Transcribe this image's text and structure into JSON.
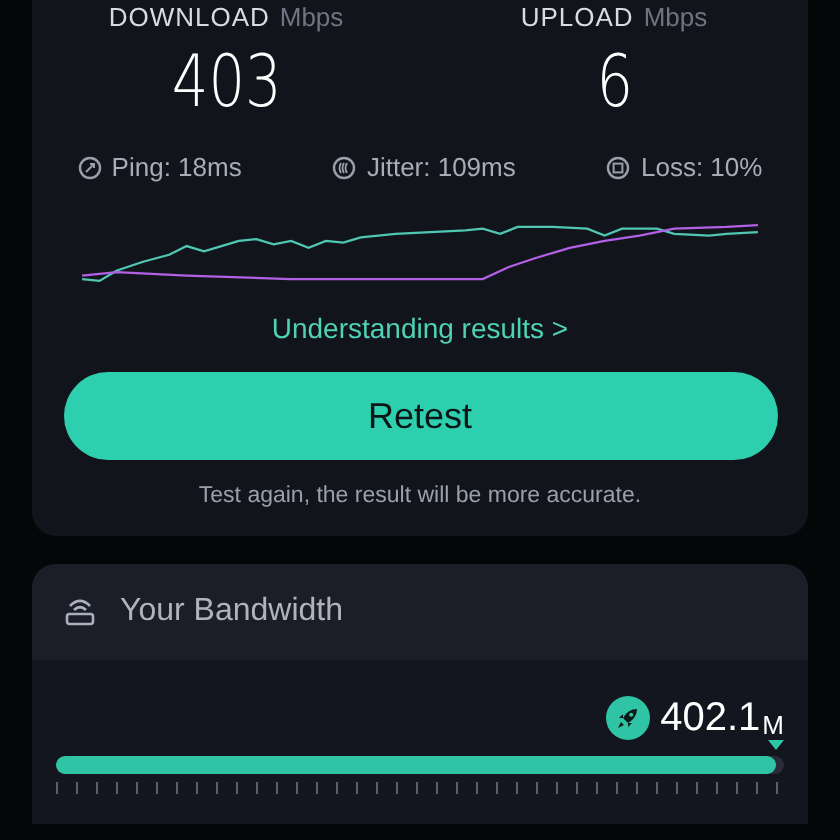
{
  "results": [
    {
      "label": "DOWNLOAD",
      "unit": "Mbps",
      "value": "403"
    },
    {
      "label": "UPLOAD",
      "unit": "Mbps",
      "value": "6"
    }
  ],
  "stats": [
    {
      "kind": "ping",
      "text": "Ping: 18ms"
    },
    {
      "kind": "jitter",
      "text": "Jitter: 109ms"
    },
    {
      "kind": "loss",
      "text": "Loss: 10%"
    }
  ],
  "link": "Understanding results >",
  "button": "Retest",
  "hint": "Test again, the result will be more accurate.",
  "bandwidth": {
    "title": "Your Bandwidth",
    "value": "402.1",
    "unit": "M",
    "level": 0.99
  }
}
